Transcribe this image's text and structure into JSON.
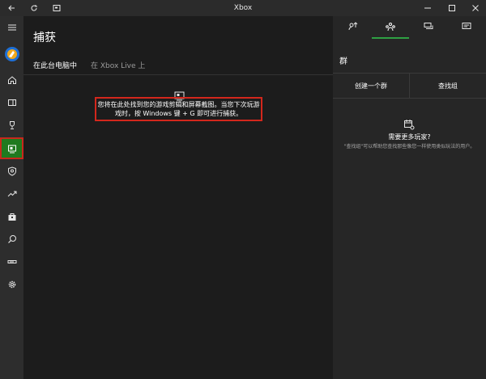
{
  "window": {
    "title": "Xbox"
  },
  "nav": {
    "items": [
      {
        "name": "menu"
      },
      {
        "name": "profile"
      },
      {
        "name": "home"
      },
      {
        "name": "my-games"
      },
      {
        "name": "achievements"
      },
      {
        "name": "captures",
        "selected": true
      },
      {
        "name": "clubs"
      },
      {
        "name": "trending"
      },
      {
        "name": "store"
      },
      {
        "name": "search"
      },
      {
        "name": "connect"
      },
      {
        "name": "settings"
      }
    ]
  },
  "main": {
    "title": "捕获",
    "tabs": [
      {
        "label": "在此台电脑中",
        "active": true
      },
      {
        "label": "在 Xbox Live 上",
        "active": false
      }
    ],
    "empty_message": "您将在此处找到您的游戏剪辑和屏幕截图。当您下次玩游戏时，按 Windows 键 + G 即可进行捕获。"
  },
  "right_panel": {
    "tabs": [
      "achievements",
      "parties",
      "messages",
      "activity"
    ],
    "active_tab": 1,
    "header": "群",
    "create_button": "创建一个群",
    "find_button": "查找组",
    "info_title": "需要更多玩家?",
    "info_desc": "\"查找组\"可以帮助您查找那些像您一样使用类似玩法的用户。"
  },
  "colors": {
    "accent_green": "#2ea043",
    "selected_bg": "#1f7a1f",
    "highlight_red": "#d3271c"
  }
}
